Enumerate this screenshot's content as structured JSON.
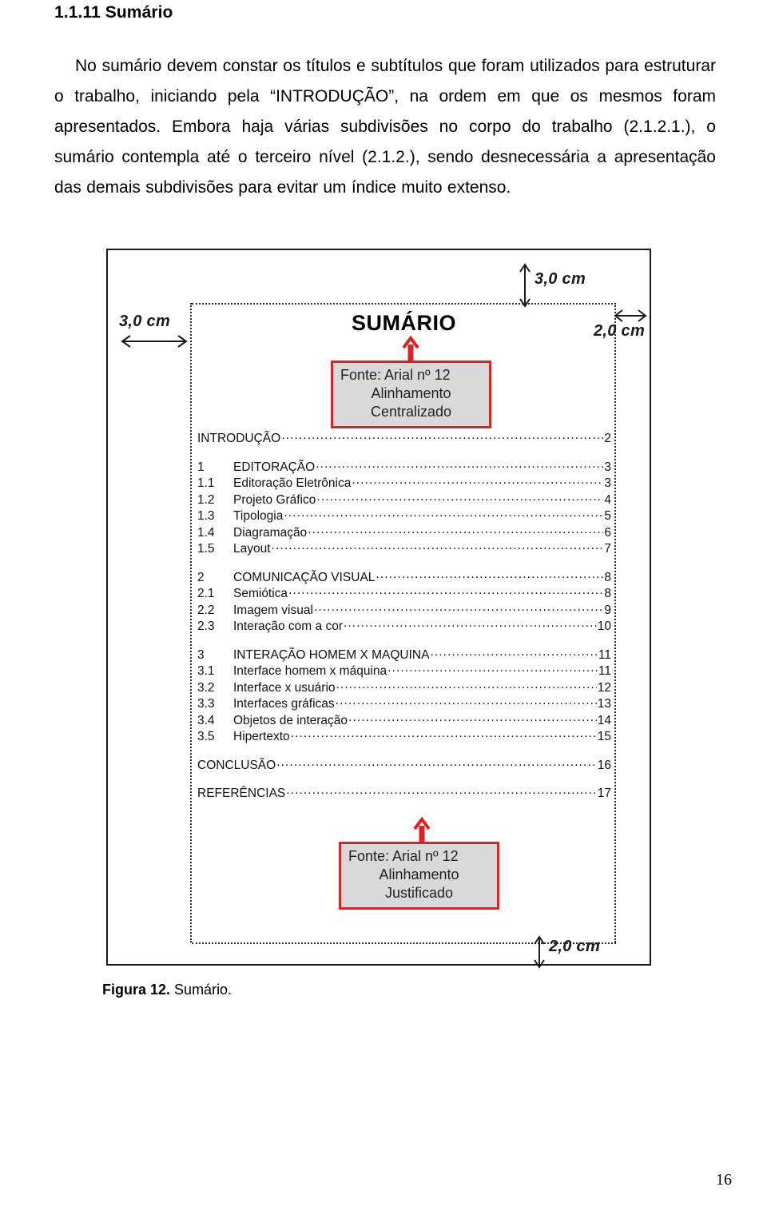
{
  "document": {
    "heading": "1.1.11 Sumário",
    "paragraph": "No sumário devem constar os títulos e subtítulos que foram utilizados para estruturar o trabalho, iniciando pela “INTRODUÇÃO”, na ordem em que os mesmos foram apresentados. Embora haja várias subdivisões no corpo do trabalho (2.1.2.1.), o sumário contempla até o terceiro nível (2.1.2.), sendo desnecessária a apresentação das demais subdivisões para evitar um índice muito extenso.",
    "caption_label": "Figura 12.",
    "caption_text": "Sumário.",
    "page_number": "16"
  },
  "figure": {
    "title": "SUMÁRIO",
    "measurements": {
      "left": "3,0 cm",
      "top_right": "3,0 cm",
      "right": "2,0 cm",
      "bottom": "2,0 cm"
    },
    "callout_top": {
      "line1": "Fonte: Arial nº 12",
      "line2": "Alinhamento",
      "line3": "Centralizado"
    },
    "callout_bottom": {
      "line1": "Fonte: Arial nº 12",
      "line2": "Alinhamento",
      "line3": "Justificado"
    },
    "toc": [
      {
        "num": "",
        "label": "INTRODUÇÃO",
        "page": "2",
        "gap_after": true
      },
      {
        "num": "1",
        "label": "EDITORAÇÃO",
        "page": "3",
        "gap_after": false
      },
      {
        "num": "1.1",
        "label": "Editoração Eletrônica",
        "page": "3",
        "gap_after": false
      },
      {
        "num": "1.2",
        "label": "Projeto Gráfico",
        "page": "4",
        "gap_after": false
      },
      {
        "num": "1.3",
        "label": "Tipologia",
        "page": "5",
        "gap_after": false
      },
      {
        "num": "1.4",
        "label": "Diagramação",
        "page": "6",
        "gap_after": false
      },
      {
        "num": "1.5",
        "label": "Layout",
        "page": "7",
        "gap_after": true
      },
      {
        "num": "2",
        "label": "COMUNICAÇÃO VISUAL",
        "page": "8",
        "gap_after": false
      },
      {
        "num": "2.1",
        "label": "Semiótica",
        "page": "8",
        "gap_after": false
      },
      {
        "num": "2.2",
        "label": "Imagem visual",
        "page": "9",
        "gap_after": false
      },
      {
        "num": "2.3",
        "label": "Interação com a cor",
        "page": "10",
        "gap_after": true
      },
      {
        "num": "3",
        "label": "INTERAÇÃO HOMEM X MAQUINA",
        "page": "11",
        "gap_after": false
      },
      {
        "num": "3.1",
        "label": "Interface homem x máquina",
        "page": "11",
        "gap_after": false
      },
      {
        "num": "3.2",
        "label": "Interface x usuário",
        "page": "12",
        "gap_after": false
      },
      {
        "num": "3.3",
        "label": "Interfaces gráficas",
        "page": "13",
        "gap_after": false
      },
      {
        "num": "3.4",
        "label": "Objetos de interação",
        "page": "14",
        "gap_after": false
      },
      {
        "num": "3.5",
        "label": "Hipertexto",
        "page": "15",
        "gap_after": true
      },
      {
        "num": "",
        "label": "CONCLUSÃO",
        "page": "16",
        "gap_after": true
      },
      {
        "num": "",
        "label": "REFERÊNCIAS",
        "page": "17",
        "gap_after": false
      }
    ]
  },
  "colors": {
    "callout_border": "#dd2222",
    "callout_fill": "#d9d9d9",
    "frame": "#1a1a1a"
  }
}
